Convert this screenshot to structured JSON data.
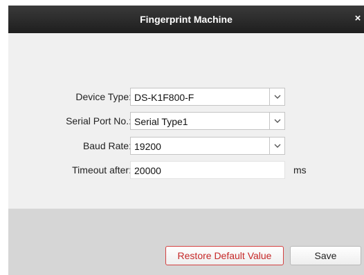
{
  "dialog": {
    "title": "Fingerprint Machine",
    "close_symbol": "×"
  },
  "form": {
    "device_type": {
      "label": "Device Type:",
      "value": "DS-K1F800-F"
    },
    "serial_port": {
      "label": "Serial Port No.:",
      "value": "Serial Type1"
    },
    "baud_rate": {
      "label": "Baud Rate:",
      "value": "19200"
    },
    "timeout": {
      "label": "Timeout after:",
      "value": "20000",
      "unit": "ms"
    }
  },
  "buttons": {
    "restore_label": "Restore Default Value",
    "save_label": "Save"
  },
  "icons": {
    "dropdown": "chevron-down-icon",
    "close": "close-icon"
  },
  "colors": {
    "titlebar": "#2b2b2b",
    "restore_text": "#c62828",
    "restore_border": "#d44040",
    "footer": "#d6d6d6",
    "panel": "#f0f0f0"
  }
}
